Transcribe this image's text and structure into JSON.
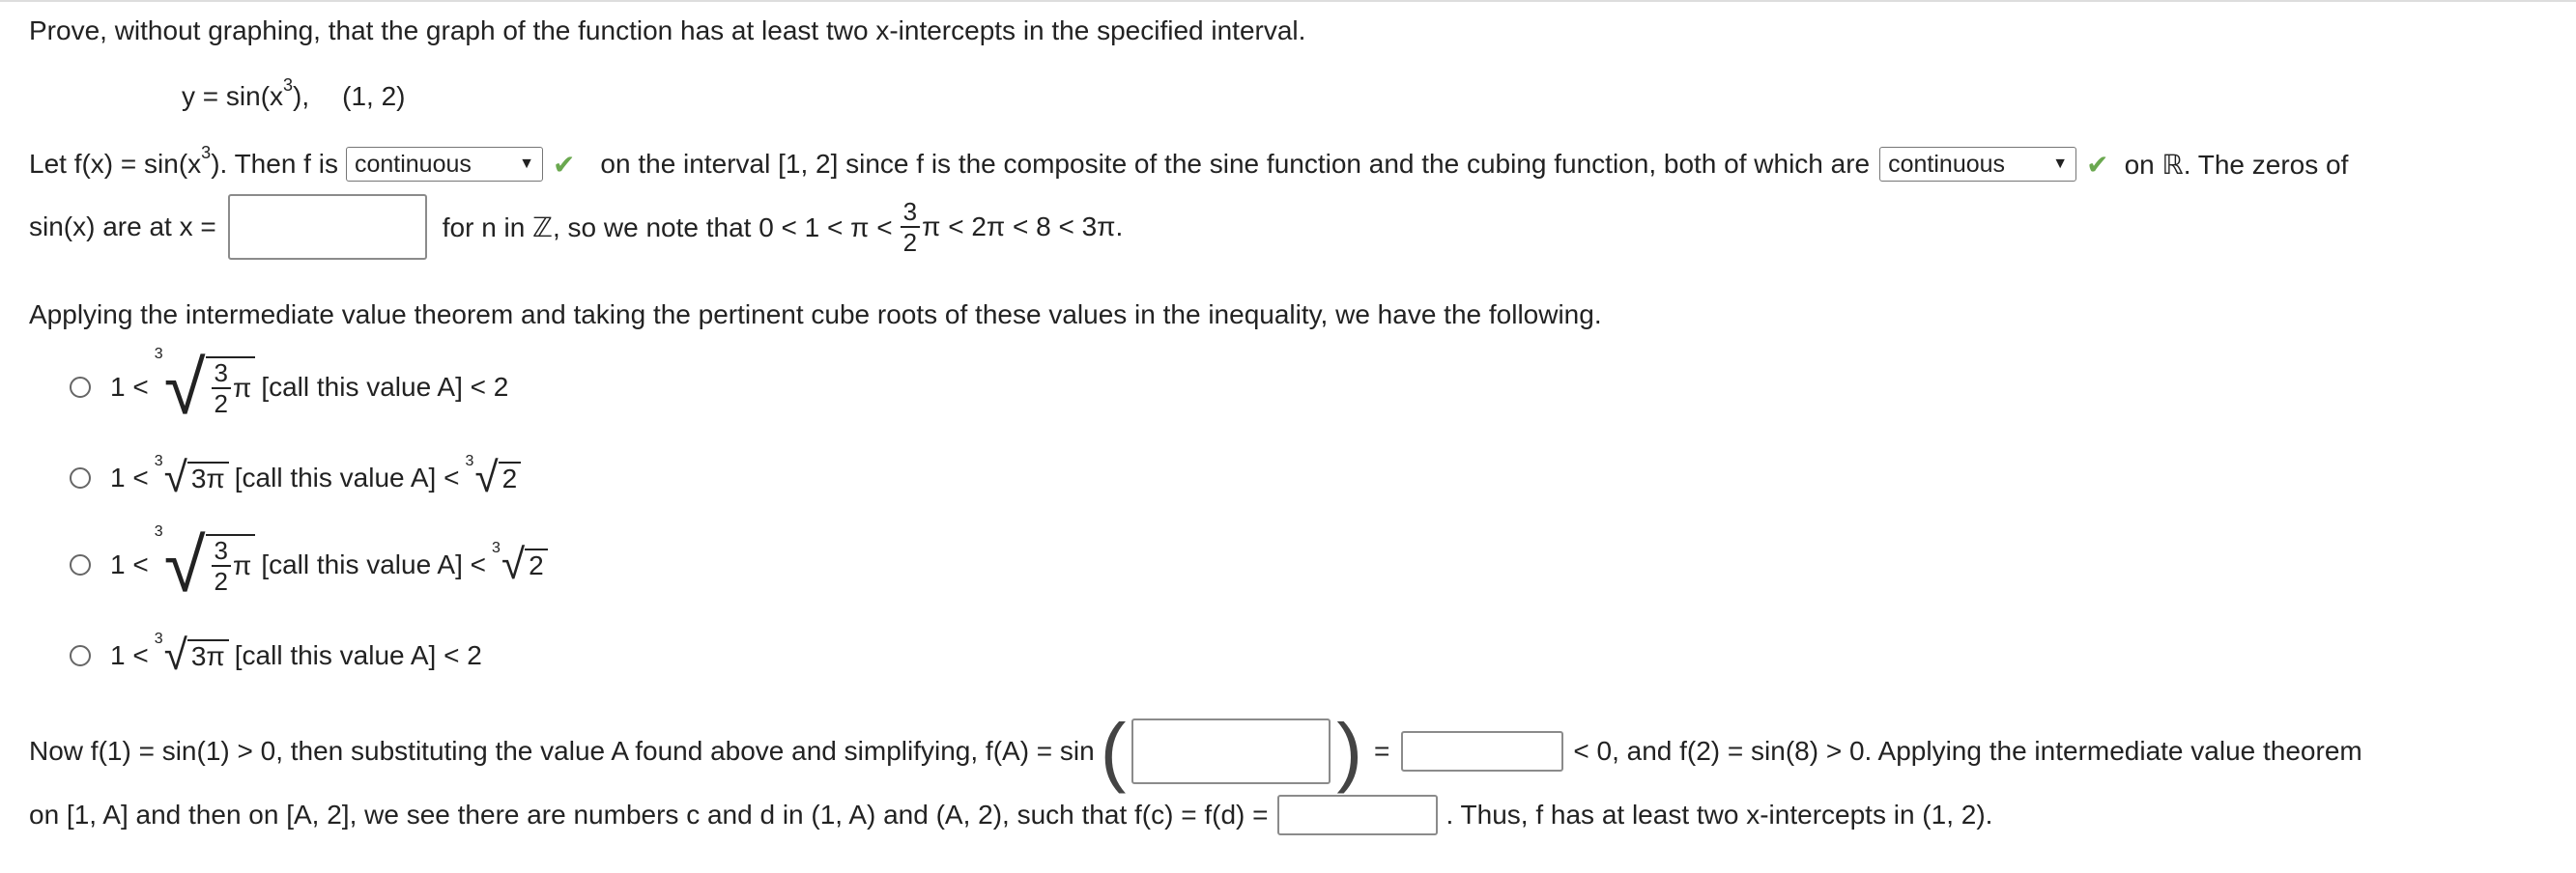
{
  "problem": {
    "instruction": "Prove, without graphing, that the graph of the function has at least two x-intercepts in the specified interval.",
    "function_text": "y = sin(x",
    "function_exponent": "3",
    "function_close": "),",
    "interval": "(1, 2)"
  },
  "paragraph1": {
    "seg1": "Let f(x) = sin(x",
    "exp": "3",
    "seg2": "). Then f is",
    "select1_value": "continuous",
    "seg3": "on the interval [1, 2] since f is the composite of the sine function and the cubing function, both of which are",
    "select2_value": "continuous",
    "seg4": "on ℝ. The zeros of",
    "seg5": "sin(x) are at x =",
    "seg6": "for n in ℤ, so we note that 0 < 1 < π <",
    "frac_num": "3",
    "frac_den": "2",
    "seg7": "π < 2π < 8 < 3π."
  },
  "paragraph2": {
    "text": "Applying the intermediate value theorem and taking the pertinent cube roots of these values in the inequality, we have the following."
  },
  "options": [
    {
      "lead": "1 <",
      "index": "3",
      "frac_num": "3",
      "frac_den": "2",
      "pi": "π",
      "mid": "[call this value A] < 2"
    },
    {
      "lead": "1 <",
      "index": "3",
      "radicand": "3π",
      "mid": "[call this value A] <",
      "rindex": "3",
      "rradicand": "2"
    },
    {
      "lead": "1 <",
      "index": "3",
      "frac_num": "3",
      "frac_den": "2",
      "pi": "π",
      "mid": "[call this value A] <",
      "rindex": "3",
      "rradicand": "2"
    },
    {
      "lead": "1 <",
      "index": "3",
      "radicand": "3π",
      "mid": "[call this value A] < 2"
    }
  ],
  "paragraph3": {
    "seg1": "Now f(1) = sin(1) > 0, then substituting the value A found above and simplifying, f(A) = sin",
    "eq": "=",
    "seg2": "< 0, and f(2) = sin(8) > 0. Applying the intermediate value theorem",
    "seg3": "on [1, A] and then on [A, 2], we see there are numbers c and d in (1, A) and (A, 2), such that f(c) = f(d) =",
    "seg4": ". Thus, f has at least two x-intercepts in (1, 2)."
  },
  "icons": {
    "check": "check-icon",
    "chevron": "chevron-down-icon"
  },
  "colors": {
    "check": "#6aa84f"
  }
}
